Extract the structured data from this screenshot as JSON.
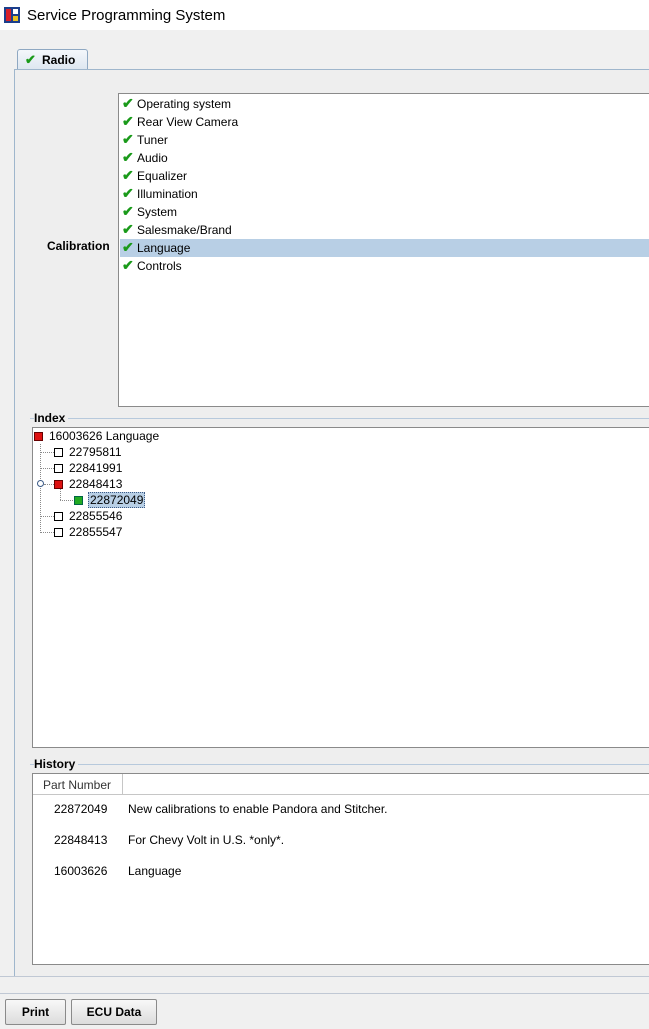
{
  "window": {
    "title": "Service Programming System"
  },
  "tabs": [
    {
      "label": "Radio",
      "checked": true
    }
  ],
  "calibration": {
    "label": "Calibration",
    "selected_index": 8,
    "items": [
      {
        "label": "Operating system",
        "checked": true
      },
      {
        "label": "Rear View Camera",
        "checked": true
      },
      {
        "label": "Tuner",
        "checked": true
      },
      {
        "label": "Audio",
        "checked": true
      },
      {
        "label": "Equalizer",
        "checked": true
      },
      {
        "label": "Illumination",
        "checked": true
      },
      {
        "label": "System",
        "checked": true
      },
      {
        "label": "Salesmake/Brand",
        "checked": true
      },
      {
        "label": "Language",
        "checked": true
      },
      {
        "label": "Controls",
        "checked": true
      }
    ]
  },
  "index": {
    "title": "Index",
    "root": {
      "label": "16003626 Language",
      "status": "red"
    },
    "children": [
      {
        "label": "22795811",
        "status": "white"
      },
      {
        "label": "22841991",
        "status": "white"
      },
      {
        "label": "22848413",
        "status": "red",
        "expanded": true,
        "children": [
          {
            "label": "22872049",
            "status": "green",
            "selected": true
          }
        ]
      },
      {
        "label": "22855546",
        "status": "white"
      },
      {
        "label": "22855547",
        "status": "white"
      }
    ]
  },
  "history": {
    "title": "History",
    "column_header": "Part Number",
    "rows": [
      {
        "part": "22872049",
        "description": "New calibrations to enable Pandora and Stitcher."
      },
      {
        "part": "22848413",
        "description": "For Chevy Volt in U.S. *only*."
      },
      {
        "part": "16003626",
        "description": "Language"
      }
    ]
  },
  "buttons": {
    "print": "Print",
    "ecu_data": "ECU Data"
  },
  "colors": {
    "check": "#1a9a1a",
    "selection": "#b8cfe5",
    "status_red": "#dd1111",
    "status_green": "#22aa22"
  },
  "icons": {
    "app": "app-icon",
    "check": "checkmark-icon"
  }
}
